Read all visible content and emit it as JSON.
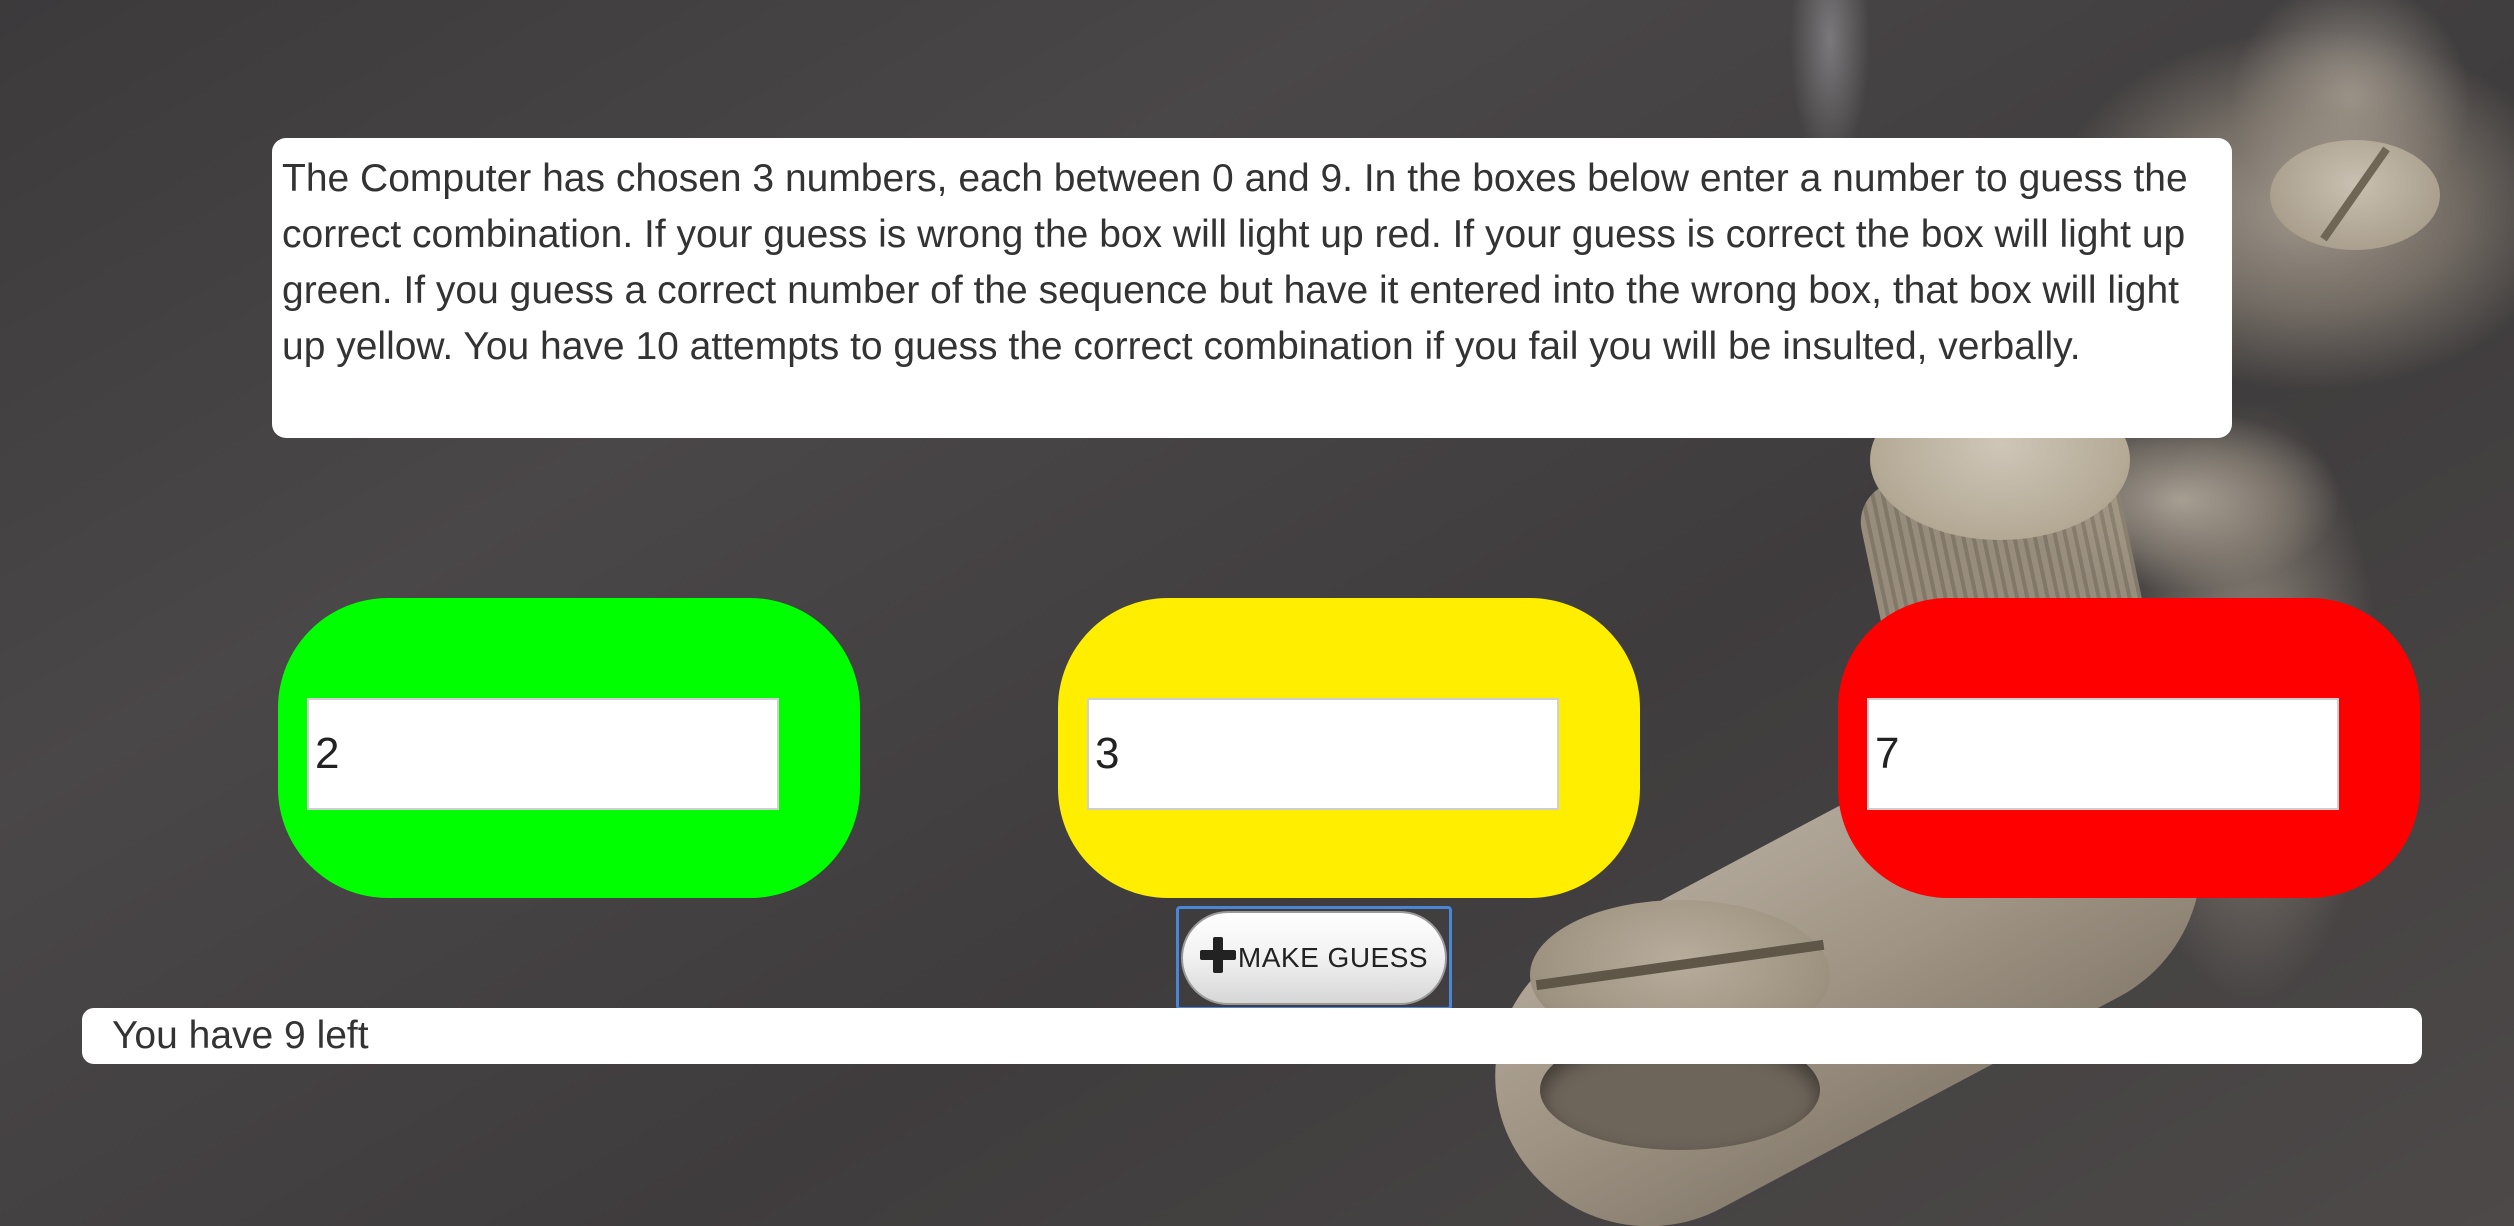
{
  "instructions": {
    "text": "The Computer has chosen 3 numbers, each between 0 and 9. In the boxes below enter a number to guess the correct combination. If your guess is wrong the box will light up red. If your guess is correct the box will light up green. If you guess a correct number of the sequence but have it entered into the wrong box, that box will light up yellow. You have 10 attempts to guess the correct combination if you fail you will be insulted, verbally."
  },
  "guesses": [
    {
      "value": "2",
      "status": "correct",
      "color": "#00ff00"
    },
    {
      "value": "3",
      "status": "wrong-position",
      "color": "#ffee00"
    },
    {
      "value": "7",
      "status": "wrong",
      "color": "#ff0000"
    }
  ],
  "make_guess": {
    "label": "MAKE GUESS",
    "icon": "plus-icon"
  },
  "status": {
    "text": "You have 9 left"
  },
  "colors": {
    "correct": "#00ff00",
    "wrong_position": "#ffee00",
    "wrong": "#ff0000",
    "focus_outline": "#4a86d8"
  }
}
